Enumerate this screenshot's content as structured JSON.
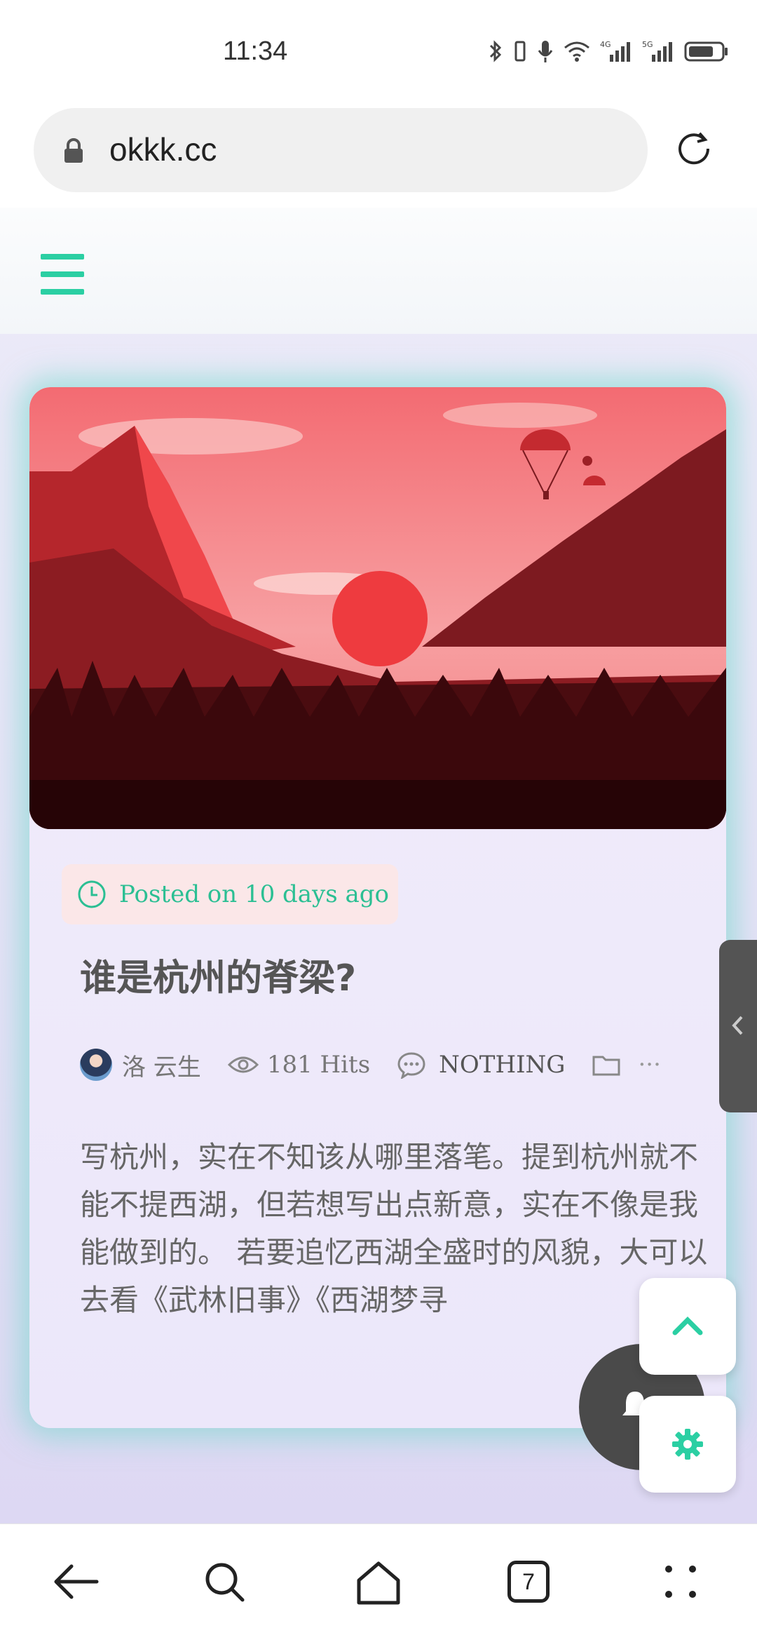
{
  "status_bar": {
    "time": "11:34",
    "icons": [
      "bluetooth-icon",
      "vibrate-icon",
      "mic-icon",
      "wifi-icon",
      "signal-4g-icon",
      "signal-5g-icon",
      "battery-icon"
    ]
  },
  "browser": {
    "url": "okkk.cc"
  },
  "colors": {
    "accent": "#2bcfa3",
    "pill_bg": "#fbe7e8",
    "fab_dark": "#4a4a4a"
  },
  "post": {
    "date_label": "Posted on 10 days ago",
    "title": "谁是杭州的脊梁?",
    "author": "洛 云生",
    "hits": "181 Hits",
    "comments": "NOTHING",
    "more": "···",
    "excerpt": "写杭州，实在不知该从哪里落笔。提到杭州就不能不提西湖，但若想写出点新意，实在不像是我能做到的。 若要追忆西湖全盛时的风貌，大可以去看《武林旧事》《西湖梦寻"
  },
  "bottom_nav": {
    "tabs_count": "7"
  }
}
